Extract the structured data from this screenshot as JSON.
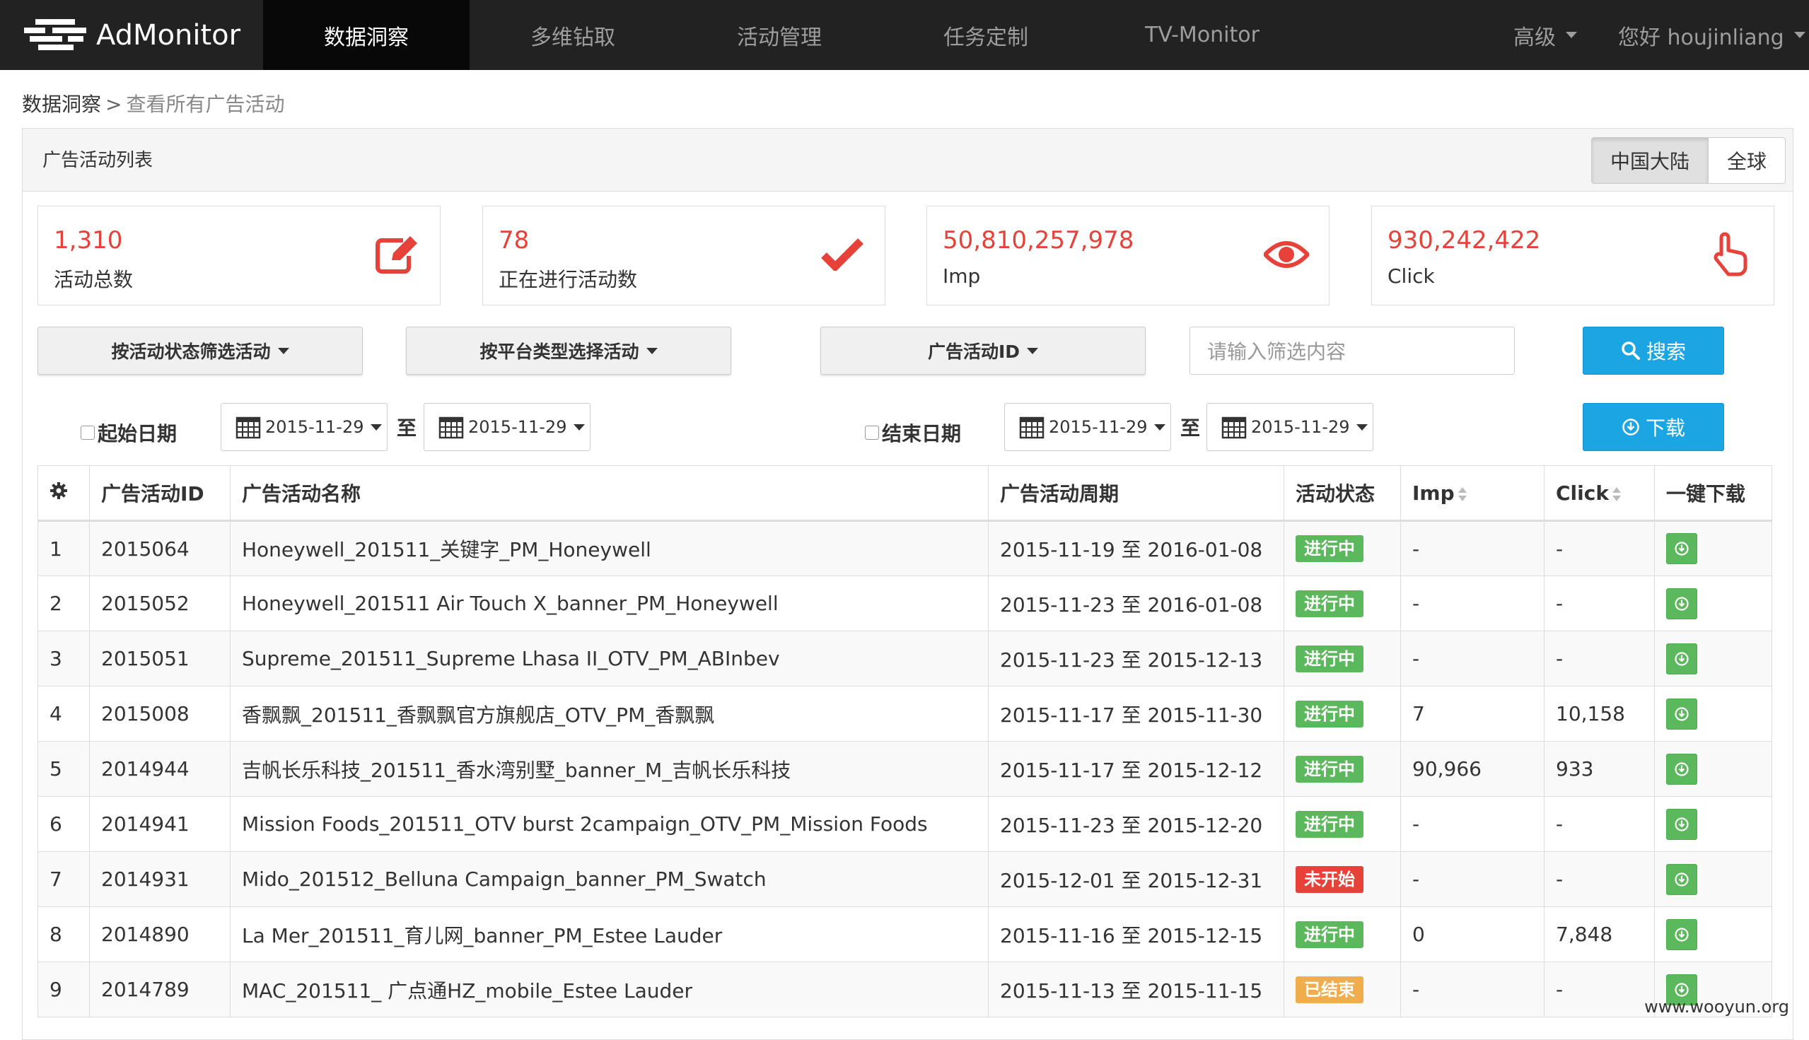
{
  "brand": {
    "name": "AdMonitor"
  },
  "nav": {
    "items": [
      {
        "label": "数据洞察",
        "active": true
      },
      {
        "label": "多维钻取",
        "active": false
      },
      {
        "label": "活动管理",
        "active": false
      },
      {
        "label": "任务定制",
        "active": false
      },
      {
        "label": "TV-Monitor",
        "active": false
      }
    ],
    "advanced": "高级",
    "user": "您好 houjinliang"
  },
  "breadcrumb": {
    "root": "数据洞察",
    "separator": ">",
    "current": "查看所有广告活动"
  },
  "panel": {
    "title": "广告活动列表",
    "regions": [
      {
        "label": "中国大陆",
        "active": true
      },
      {
        "label": "全球",
        "active": false
      }
    ]
  },
  "stats": [
    {
      "value": "1,310",
      "label": "活动总数",
      "icon": "edit-icon"
    },
    {
      "value": "78",
      "label": "正在进行活动数",
      "icon": "check-icon"
    },
    {
      "value": "50,810,257,978",
      "label": "Imp",
      "icon": "eye-icon"
    },
    {
      "value": "930,242,422",
      "label": "Click",
      "icon": "hand-pointer-icon"
    }
  ],
  "filters": {
    "status": "按活动状态筛选活动",
    "platform": "按平台类型选择活动",
    "field": "广告活动ID",
    "placeholder": "请输入筛选内容",
    "search": "搜索",
    "download": "下载"
  },
  "dates": {
    "start_label": "起始日期",
    "end_label": "结束日期",
    "to": "至",
    "start_from": "2015-11-29",
    "start_to": "2015-11-29",
    "end_from": "2015-11-29",
    "end_to": "2015-11-29"
  },
  "table": {
    "headers": [
      "广告活动ID",
      "广告活动名称",
      "广告活动周期",
      "活动状态",
      "Imp",
      "Click",
      "一键下载"
    ],
    "rows": [
      {
        "idx": "1",
        "id": "2015064",
        "name": "Honeywell_201511_关键字_PM_Honeywell",
        "period": "2015-11-19 至 2016-01-08",
        "status": "进行中",
        "status_color": "#5cb85c",
        "imp": "-",
        "click": "-"
      },
      {
        "idx": "2",
        "id": "2015052",
        "name": "Honeywell_201511 Air Touch X_banner_PM_Honeywell",
        "period": "2015-11-23 至 2016-01-08",
        "status": "进行中",
        "status_color": "#5cb85c",
        "imp": "-",
        "click": "-"
      },
      {
        "idx": "3",
        "id": "2015051",
        "name": "Supreme_201511_Supreme Lhasa II_OTV_PM_ABInbev",
        "period": "2015-11-23 至 2015-12-13",
        "status": "进行中",
        "status_color": "#5cb85c",
        "imp": "-",
        "click": "-"
      },
      {
        "idx": "4",
        "id": "2015008",
        "name": "香飘飘_201511_香飘飘官方旗舰店_OTV_PM_香飘飘",
        "period": "2015-11-17 至 2015-11-30",
        "status": "进行中",
        "status_color": "#5cb85c",
        "imp": "7",
        "click": "10,158"
      },
      {
        "idx": "5",
        "id": "2014944",
        "name": "吉帆长乐科技_201511_香水湾别墅_banner_M_吉帆长乐科技",
        "period": "2015-11-17 至 2015-12-12",
        "status": "进行中",
        "status_color": "#5cb85c",
        "imp": "90,966",
        "click": "933"
      },
      {
        "idx": "6",
        "id": "2014941",
        "name": "Mission Foods_201511_OTV burst 2campaign_OTV_PM_Mission Foods",
        "period": "2015-11-23 至 2015-12-20",
        "status": "进行中",
        "status_color": "#5cb85c",
        "imp": "-",
        "click": "-"
      },
      {
        "idx": "7",
        "id": "2014931",
        "name": "Mido_201512_Belluna Campaign_banner_PM_Swatch",
        "period": "2015-12-01 至 2015-12-31",
        "status": "未开始",
        "status_color": "#e7423a",
        "imp": "-",
        "click": "-"
      },
      {
        "idx": "8",
        "id": "2014890",
        "name": "La Mer_201511_育儿网_banner_PM_Estee Lauder",
        "period": "2015-11-16 至 2015-12-15",
        "status": "进行中",
        "status_color": "#5cb85c",
        "imp": "0",
        "click": "7,848"
      },
      {
        "idx": "9",
        "id": "2014789",
        "name": "MAC_201511_ 广点通HZ_mobile_Estee Lauder",
        "period": "2015-11-13 至 2015-11-15",
        "status": "已结束",
        "status_color": "#f0ad4e",
        "imp": "-",
        "click": "-"
      }
    ]
  },
  "watermark": "www.wooyun.org",
  "colors": {
    "accent": "#e7423a",
    "primary": "#1ba5e2",
    "success": "#5cb85c",
    "warning": "#f0ad4e",
    "navbar": "#222222"
  }
}
